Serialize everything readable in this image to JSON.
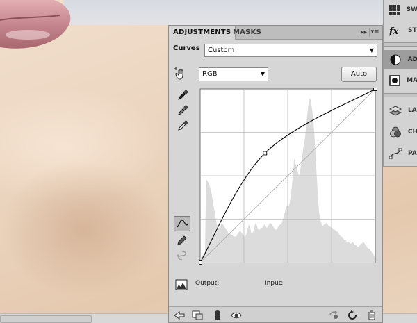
{
  "panel": {
    "tabs": [
      {
        "label": "ADJUSTMENTS"
      },
      {
        "label": "MASKS"
      }
    ],
    "collapse_glyph": "▸▸",
    "menu_glyph": "▾≡"
  },
  "curves": {
    "title": "Curves",
    "preset": "Custom",
    "channel": "RGB",
    "auto_label": "Auto",
    "output_label": "Output:",
    "input_label": "Input:",
    "curve_points": [
      [
        0,
        0
      ],
      [
        0.37,
        0.63
      ],
      [
        1,
        1
      ]
    ],
    "histogram": [
      0.03,
      0.03,
      0.04,
      0.05,
      0.05,
      0.48,
      0.47,
      0.46,
      0.44,
      0.42,
      0.38,
      0.34,
      0.3,
      0.26,
      0.22,
      0.2,
      0.2,
      0.21,
      0.22,
      0.22,
      0.21,
      0.2,
      0.19,
      0.18,
      0.17,
      0.17,
      0.16,
      0.16,
      0.15,
      0.15,
      0.15,
      0.16,
      0.17,
      0.18,
      0.18,
      0.17,
      0.16,
      0.15,
      0.15,
      0.17,
      0.2,
      0.22,
      0.2,
      0.17,
      0.17,
      0.19,
      0.22,
      0.23,
      0.2,
      0.19,
      0.19,
      0.2,
      0.2,
      0.21,
      0.22,
      0.21,
      0.2,
      0.21,
      0.22,
      0.23,
      0.22,
      0.21,
      0.2,
      0.19,
      0.19,
      0.2,
      0.21,
      0.22,
      0.22,
      0.24,
      0.26,
      0.29,
      0.32,
      0.33,
      0.32,
      0.34,
      0.38,
      0.44,
      0.52,
      0.6,
      0.58,
      0.55,
      0.52,
      0.5,
      0.53,
      0.58,
      0.63,
      0.68,
      0.72,
      0.78,
      0.86,
      0.92,
      0.95,
      0.93,
      0.88,
      0.82,
      0.72,
      0.6,
      0.48,
      0.36,
      0.28,
      0.24,
      0.22,
      0.21,
      0.22,
      0.22,
      0.23,
      0.22,
      0.21,
      0.21,
      0.2,
      0.2,
      0.19,
      0.19,
      0.18,
      0.18,
      0.17,
      0.16,
      0.15,
      0.15,
      0.14,
      0.13,
      0.13,
      0.12,
      0.12,
      0.12,
      0.11,
      0.11,
      0.12,
      0.11,
      0.1,
      0.1,
      0.09,
      0.09,
      0.1,
      0.11,
      0.11,
      0.12,
      0.11,
      0.1,
      0.09,
      0.08,
      0.08,
      0.07,
      0.06,
      0.05,
      0.04,
      0.03
    ]
  },
  "dock": {
    "items": [
      {
        "label": "SW",
        "icon": "swatches-icon"
      },
      {
        "label": "ST",
        "icon": "styles-icon"
      },
      {
        "label": "AD",
        "icon": "adjustments-icon"
      },
      {
        "label": "MA",
        "icon": "masks-icon"
      },
      {
        "label": "LA",
        "icon": "layers-icon"
      },
      {
        "label": "CH",
        "icon": "channels-icon"
      },
      {
        "label": "PA",
        "icon": "paths-icon"
      }
    ]
  },
  "colors": {
    "panel_bg": "#d6d6d6",
    "graph_bg": "#ffffff",
    "histogram": "#dcdcdc",
    "curve": "#000000",
    "baseline": "#a8a8a8"
  }
}
